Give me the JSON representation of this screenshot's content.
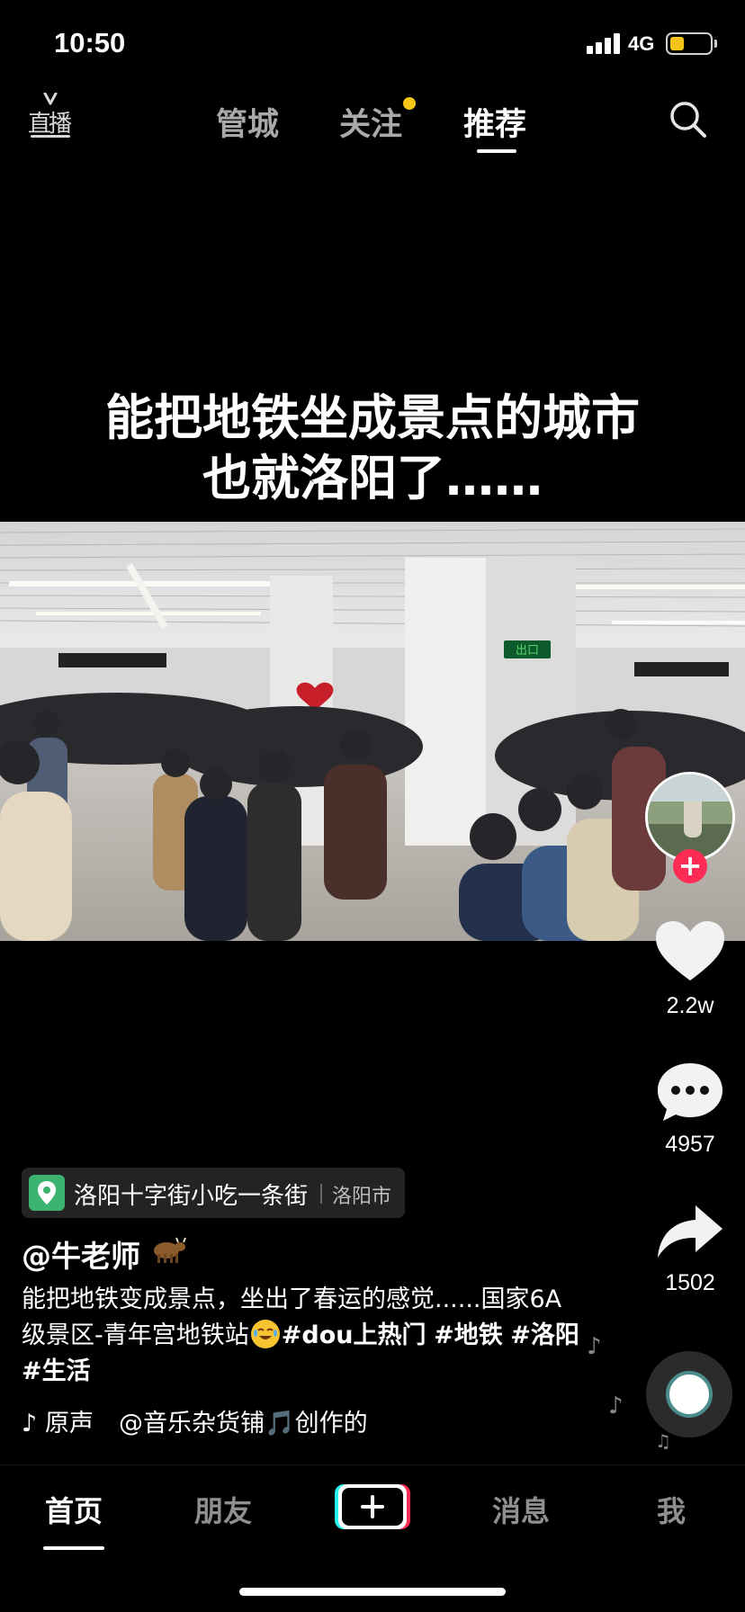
{
  "status_bar": {
    "time": "10:50",
    "network": "4G",
    "battery_level": 0.35,
    "battery_color": "#f5c518"
  },
  "top_nav": {
    "live_label": "直播",
    "tabs": [
      {
        "label": "管城",
        "active": false
      },
      {
        "label": "关注",
        "active": false,
        "has_dot": true
      },
      {
        "label": "推荐",
        "active": true
      }
    ],
    "search_icon": "search-icon",
    "notification_dot_color": "#f5c518"
  },
  "video": {
    "caption_line1": "能把地铁坐成景点的城市",
    "caption_line2": "也就洛阳了……",
    "exit_sign": "出口"
  },
  "actions": {
    "like_count": "2.2w",
    "comment_count": "4957",
    "share_count": "1502",
    "follow_label": "+",
    "accent_color": "#fe2c55"
  },
  "info": {
    "location_name": "洛阳十字街小吃一条街",
    "location_city": "洛阳市",
    "author": "@牛老师",
    "description_text": "能把地铁变成景点，坐出了春运的感觉......国家6A级景区-青年宫地铁站",
    "hashtags": [
      "#dou上热门",
      "#地铁",
      "#洛阳",
      "#生活"
    ],
    "music_prefix": "",
    "music_line1": "原声",
    "music_line2": "@音乐杂货铺🎵创作的"
  },
  "bottom_tabs": {
    "items": [
      {
        "label": "首页",
        "active": true
      },
      {
        "label": "朋友",
        "active": false
      },
      {
        "label": "消息",
        "active": false
      },
      {
        "label": "我",
        "active": false
      }
    ],
    "create_label": "+"
  }
}
